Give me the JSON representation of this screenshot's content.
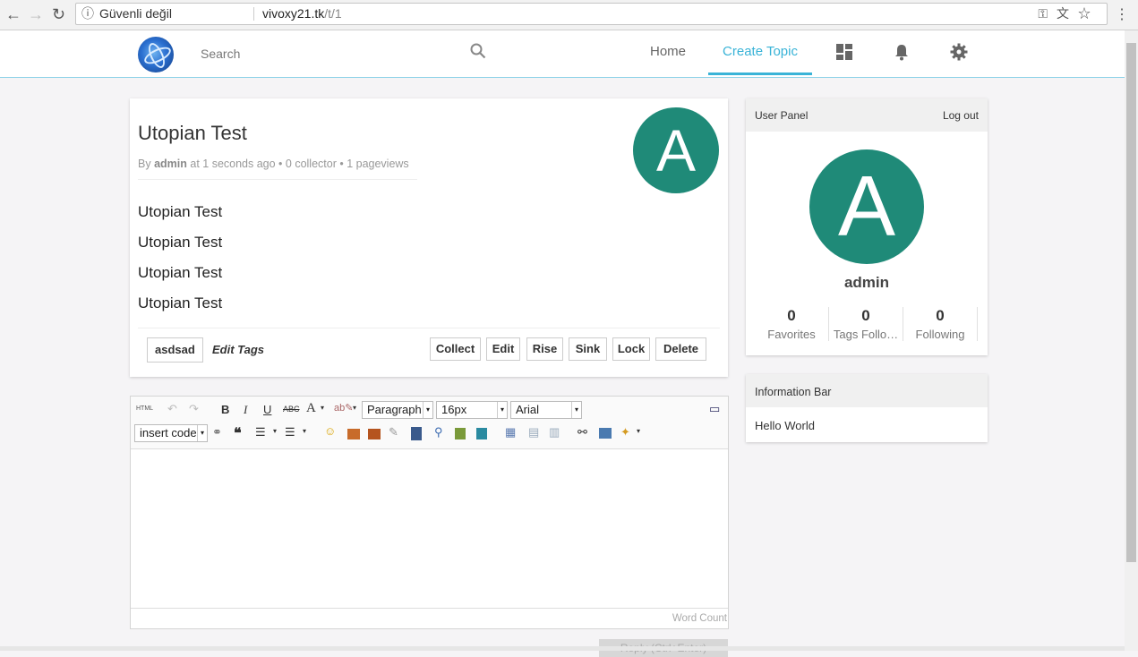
{
  "browser": {
    "security_label": "Güvenli değil",
    "url_host": "vivoxy21.tk",
    "url_path": "/t/1"
  },
  "header": {
    "search_placeholder": "Search",
    "nav": {
      "home": "Home",
      "create_topic": "Create Topic"
    }
  },
  "topic": {
    "title": "Utopian Test",
    "meta_by": "By",
    "author": "admin",
    "meta_rest": "at 1 seconds ago • 0 collector • 1 pageviews",
    "avatar_letter": "A",
    "body_lines": [
      "Utopian Test",
      "Utopian Test",
      "Utopian Test",
      "Utopian Test"
    ],
    "tag": "asdsad",
    "edit_tags": "Edit Tags",
    "actions": [
      "Collect",
      "Edit",
      "Rise",
      "Sink",
      "Lock",
      "Delete"
    ]
  },
  "editor": {
    "html_label": "HTML",
    "paragraph": "Paragraph",
    "font_size": "16px",
    "font_family": "Arial",
    "insert_code": "insert code",
    "word_count": "Word Count",
    "reply_label": "Reply (Ctrl+Enter)"
  },
  "user_panel": {
    "title": "User Panel",
    "logout": "Log out",
    "avatar_letter": "A",
    "username": "admin",
    "stats": [
      {
        "value": "0",
        "label": "Favorites"
      },
      {
        "value": "0",
        "label": "Tags Follo…"
      },
      {
        "value": "0",
        "label": "Following"
      }
    ]
  },
  "info_bar": {
    "title": "Information Bar",
    "text": "Hello World"
  },
  "colors": {
    "accent": "#39b3d7",
    "avatar": "#1f8a78"
  }
}
